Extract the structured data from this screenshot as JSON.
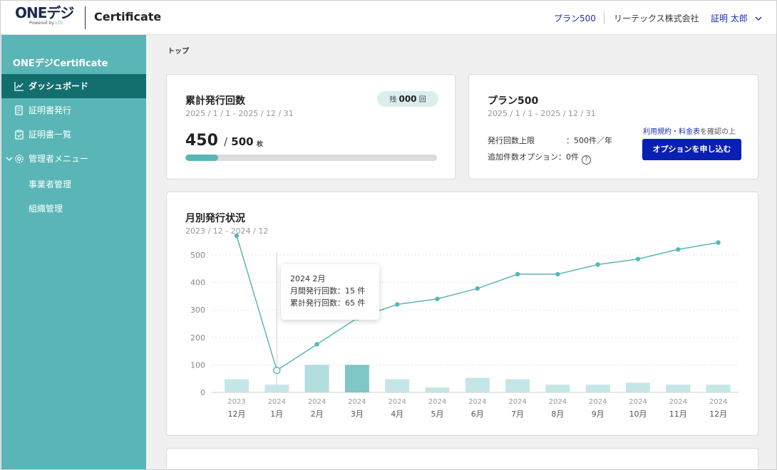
{
  "header": {
    "logo_text": "ONEデジ",
    "logo_sub": "Powered by",
    "logo_sub_brand": "LTS",
    "app_title": "Certificate",
    "plan_link": "プラン500",
    "company": "リーテックス株式会社",
    "user_name": "証明 太郎"
  },
  "sidebar": {
    "title": "ONEデジCertificate",
    "items": [
      {
        "label": "ダッシュボード",
        "icon": "chart-icon"
      },
      {
        "label": "証明書発行",
        "icon": "document-edit-icon"
      },
      {
        "label": "証明書一覧",
        "icon": "clipboard-icon"
      },
      {
        "label": "管理者メニュー",
        "icon": "gear-icon"
      }
    ],
    "sub_items": [
      {
        "label": "事業者管理"
      },
      {
        "label": "組織管理"
      }
    ]
  },
  "breadcrumb": "トップ",
  "usage_card": {
    "title": "累計発行回数",
    "period": "2025 / 1 / 1 - 2025 / 12 / 31",
    "remaining_prefix": "残",
    "remaining_value": "000",
    "remaining_suffix": "回",
    "count": "450",
    "slash": "/",
    "total": "500",
    "unit": "枚",
    "progress_fraction": 0.13
  },
  "plan_card": {
    "title": "プラン500",
    "period": "2025 / 1 / 1 - 2025 / 12 / 31",
    "limit_label": "発行回数上限",
    "limit_value": "：500件／年",
    "option_label": "追加件数オプション：0件",
    "terms_link1": "利用規約",
    "terms_sep": "・",
    "terms_link2": "料金表",
    "terms_suffix": "を確認の上",
    "apply_button": "オプションを申し込む"
  },
  "chart_card": {
    "title": "月別発行状況",
    "range": "2023 / 12  - 2024 / 12"
  },
  "tooltip": {
    "title": "2024 2月",
    "monthly": "月間発行回数：15 件",
    "cumulative": "累計発行回数：65 件"
  },
  "colors": {
    "sidebar": "#5ab6b6",
    "sidebar_active": "#136e6e",
    "accent_link": "#1a2fb0",
    "button": "#0a1fb4",
    "line": "#5ab6b6",
    "bar": "#bfe3e3",
    "bar_highlight": "#b2dede",
    "bar_selected": "#7fc6c6"
  },
  "chart_data": {
    "type": "bar+line",
    "categories_year": [
      "2023",
      "2024",
      "2024",
      "2024",
      "2024",
      "2024",
      "2024",
      "2024",
      "2024",
      "2024",
      "2024",
      "2024",
      "2024"
    ],
    "categories_month": [
      "12月",
      "1月",
      "2月",
      "3月",
      "4月",
      "5月",
      "6月",
      "7月",
      "8月",
      "9月",
      "10月",
      "11月",
      "12月"
    ],
    "series": [
      {
        "type": "bar",
        "values": [
          48,
          28,
          100,
          100,
          48,
          18,
          53,
          48,
          28,
          28,
          35,
          28,
          28
        ]
      },
      {
        "type": "line",
        "values": [
          570,
          80,
          175,
          270,
          320,
          340,
          378,
          430,
          430,
          465,
          485,
          520,
          545
        ]
      }
    ],
    "yticks": [
      0,
      100,
      200,
      300,
      400,
      500
    ],
    "ylim": [
      0,
      500
    ],
    "highlight_index": 2,
    "selected_index": 3,
    "hover_index": 1,
    "grid": true
  }
}
